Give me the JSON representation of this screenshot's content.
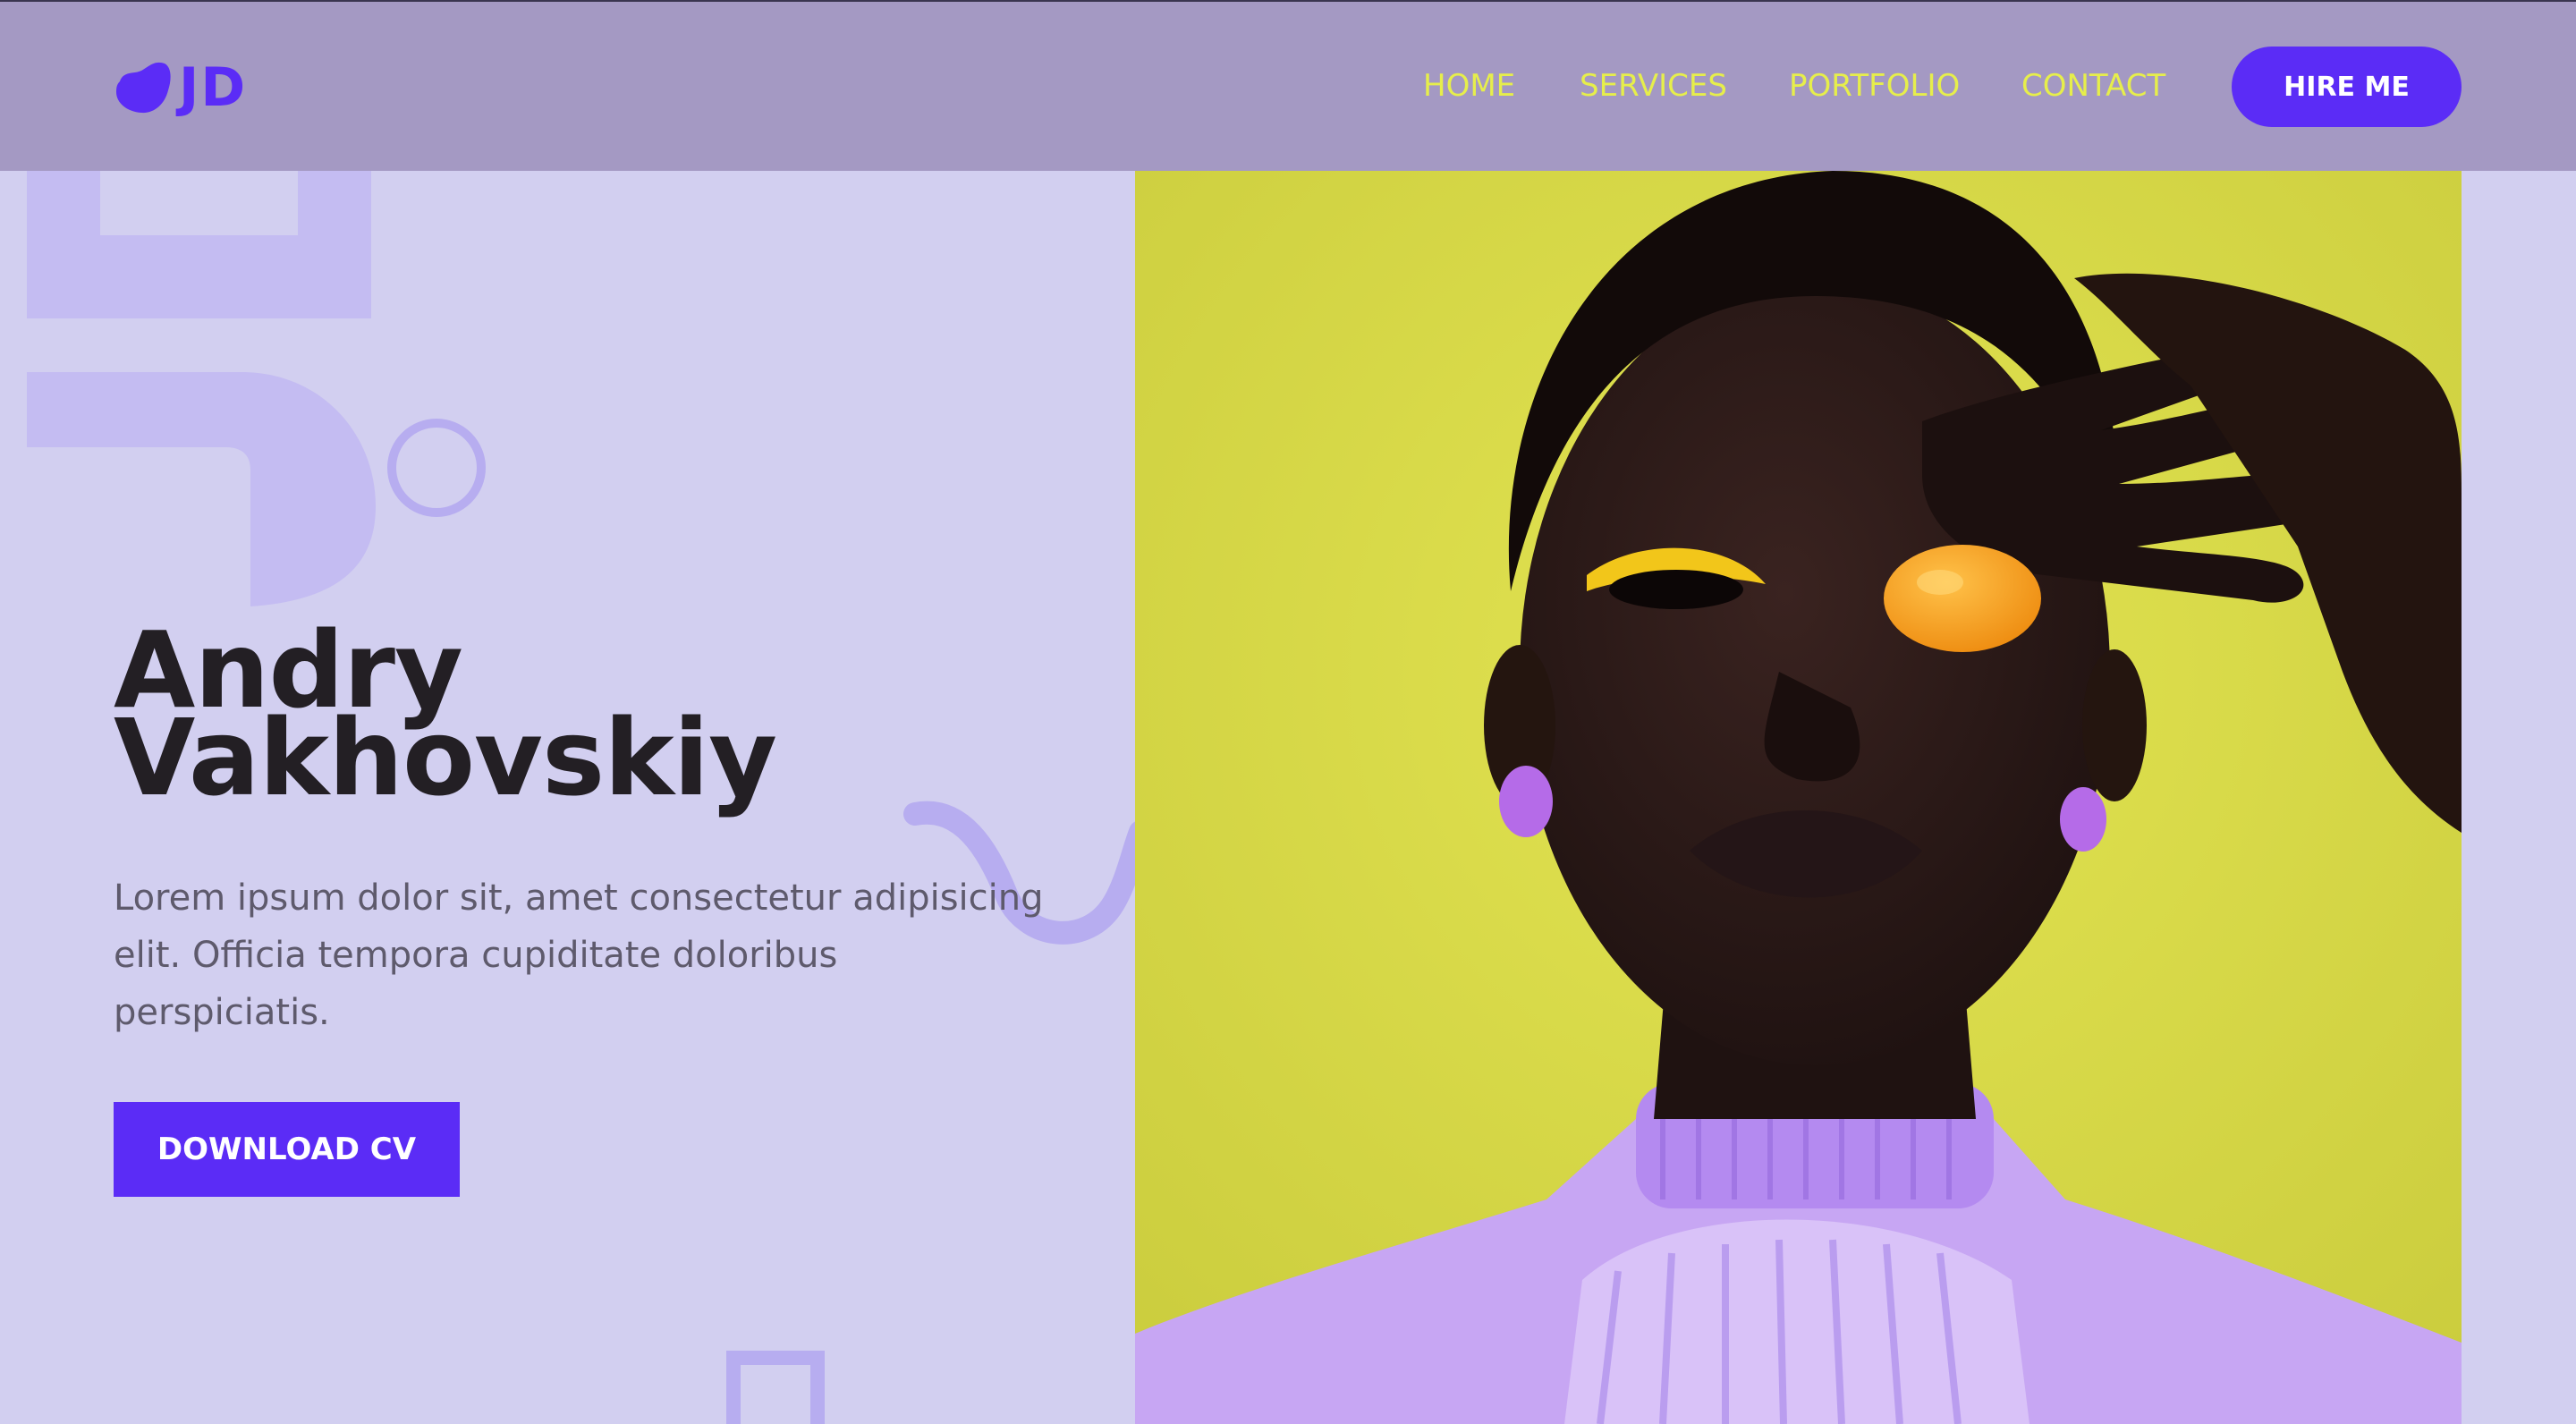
{
  "brand": {
    "logo_text": "JD",
    "logo_icon": "blob-logo-icon",
    "accent_color": "#5b2cf6"
  },
  "nav": {
    "items": [
      {
        "label": "HOME"
      },
      {
        "label": "SERVICES"
      },
      {
        "label": "PORTFOLIO"
      },
      {
        "label": "CONTACT"
      }
    ],
    "hire_label": "HIRE ME",
    "link_color": "#e6ee4b"
  },
  "hero": {
    "first_name": "Andry",
    "last_name": "Vakhovskiy",
    "description": "Lorem ipsum dolor sit, amet consectetur adipisicing elit. Officia tempora cupiditate doloribus perspiciatis.",
    "cta_label": "DOWNLOAD CV"
  },
  "colors": {
    "header_bg": "#a499c3",
    "page_bg": "#d2cff0",
    "photo_bg": "#ddde4c"
  }
}
